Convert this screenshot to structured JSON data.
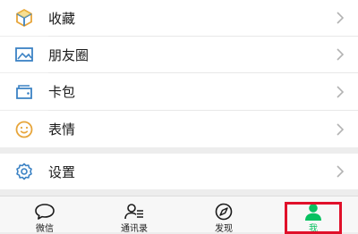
{
  "menu": {
    "items": [
      {
        "label": "收藏",
        "icon": "favorites-cube-icon"
      },
      {
        "label": "朋友圈",
        "icon": "moments-picture-icon"
      },
      {
        "label": "卡包",
        "icon": "card-wallet-icon"
      },
      {
        "label": "表情",
        "icon": "sticker-smile-icon"
      },
      {
        "label": "设置",
        "icon": "settings-gear-icon"
      }
    ]
  },
  "tabbar": {
    "tabs": [
      {
        "label": "微信",
        "icon": "chat-bubble-icon",
        "active": false
      },
      {
        "label": "通讯录",
        "icon": "contacts-icon",
        "active": false
      },
      {
        "label": "发现",
        "icon": "compass-icon",
        "active": false
      },
      {
        "label": "我",
        "icon": "person-icon",
        "active": true
      }
    ],
    "colors": {
      "active": "#07c160",
      "highlight_box": "#e0102a",
      "menu_icon_blue": "#3b82c4",
      "menu_icon_gold": "#e7a53a"
    }
  }
}
